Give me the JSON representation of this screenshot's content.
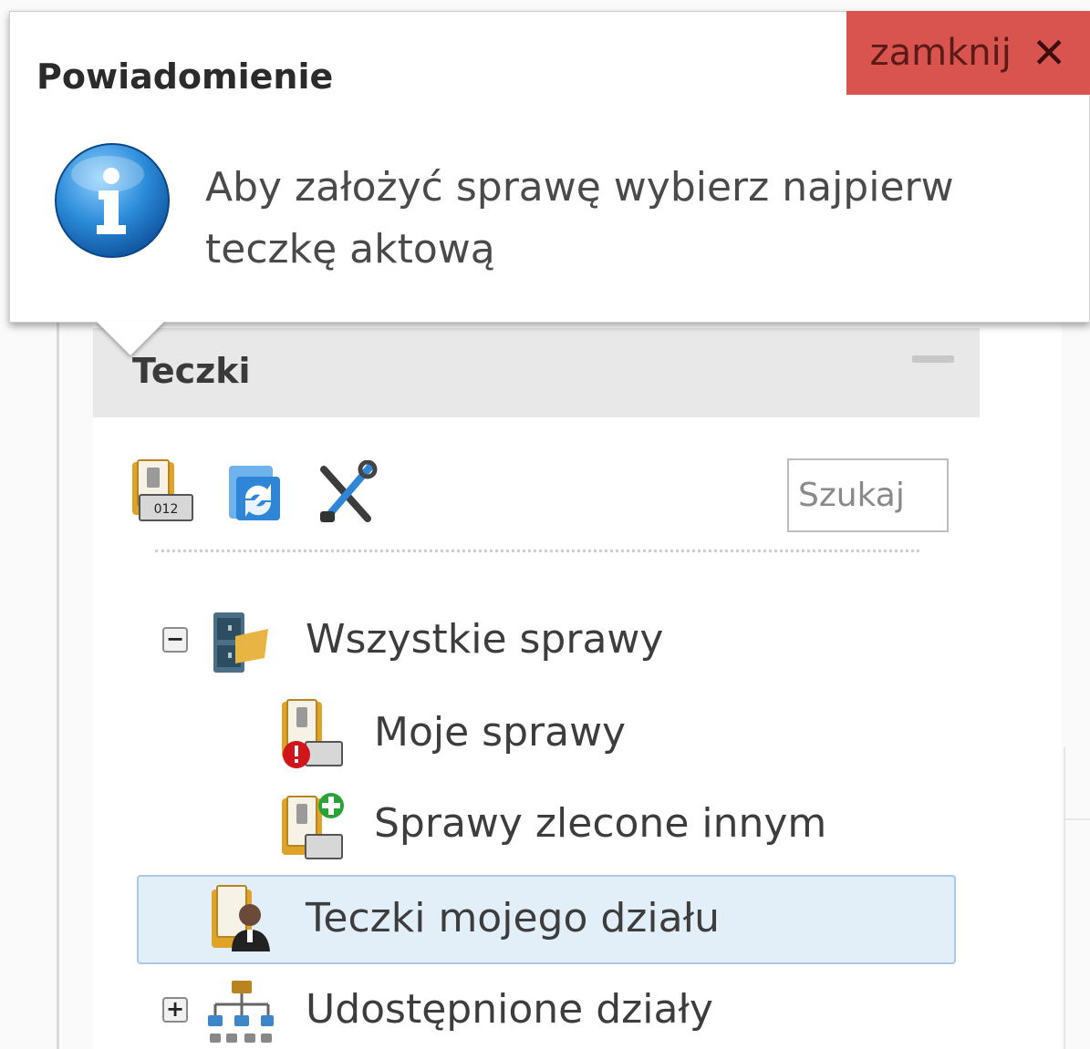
{
  "notification": {
    "title": "Powiadomienie",
    "close_label": "zamknij",
    "close_glyph": "✕",
    "message": "Aby założyć sprawę wybierz najpierw teczkę aktową",
    "icon": "info-icon"
  },
  "panel": {
    "title": "Teczki",
    "toolbar": {
      "icons": [
        "case-folder-icon",
        "refresh-icon",
        "settings-tools-icon"
      ],
      "search_placeholder": "Szukaj"
    },
    "tree": {
      "items": [
        {
          "label": "Wszystkie sprawy",
          "icon": "filing-cabinet-icon",
          "toggle": "−",
          "expanded": true
        },
        {
          "label": "Moje sprawy",
          "icon": "folder-alert-icon"
        },
        {
          "label": "Sprawy zlecone innym",
          "icon": "folder-add-icon"
        },
        {
          "label": "Teczki mojego działu",
          "icon": "folder-user-icon",
          "selected": true
        },
        {
          "label": "Udostępnione działy",
          "icon": "org-chart-icon",
          "toggle": "+",
          "expanded": false
        }
      ]
    }
  },
  "colors": {
    "close_bg": "#d9534f",
    "header_bg": "#e8e8e8",
    "selected_bg": "#e2eef8",
    "selected_border": "#a9c9e6",
    "info_blue": "#1f7fc9"
  }
}
